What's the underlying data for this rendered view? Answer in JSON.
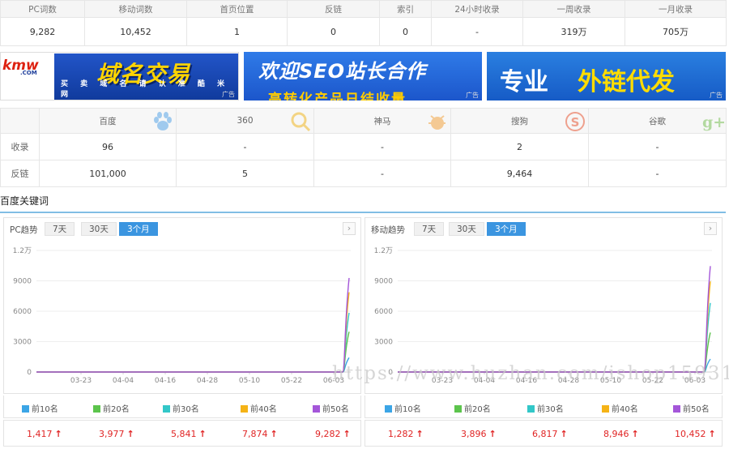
{
  "stats": {
    "headers": [
      "PC词数",
      "移动词数",
      "首页位置",
      "反链",
      "索引",
      "24小时收录",
      "一周收录",
      "一月收录"
    ],
    "values": [
      "9,282",
      "10,452",
      "1",
      "0",
      "0",
      "-",
      "319万",
      "705万"
    ]
  },
  "ads": {
    "ad1": {
      "logo_main": "kmw",
      "logo_suffix": ".COM",
      "title": "域名交易",
      "sub": "买 卖 域 名 请 认 准 酷 米 网",
      "tag": "广告"
    },
    "ad2": {
      "title": "欢迎SEO站长合作",
      "sub": "高转化产品日结收量",
      "tag": "广告"
    },
    "ad3": {
      "w1": "专业",
      "w2": "外链代发",
      "tag": "广告"
    }
  },
  "engines": {
    "headers": [
      "百度",
      "360",
      "神马",
      "搜狗",
      "谷歌"
    ],
    "rows": [
      {
        "label": "收录",
        "values": [
          "96",
          "-",
          "-",
          "2",
          "-"
        ]
      },
      {
        "label": "反链",
        "values": [
          "101,000",
          "5",
          "-",
          "9,464",
          "-"
        ]
      }
    ]
  },
  "section_title": "百度关键词",
  "panels": [
    {
      "title": "PC趋势",
      "tabs": [
        "7天",
        "30天",
        "3个月"
      ],
      "active_tab": "3个月",
      "nav": "›",
      "legend": [
        "前10名",
        "前20名",
        "前30名",
        "前40名",
        "前50名"
      ],
      "values": [
        "1,417",
        "3,977",
        "5,841",
        "7,874",
        "9,282"
      ],
      "arrow": "↑"
    },
    {
      "title": "移动趋势",
      "tabs": [
        "7天",
        "30天",
        "3个月"
      ],
      "active_tab": "3个月",
      "nav": "›",
      "legend": [
        "前10名",
        "前20名",
        "前30名",
        "前40名",
        "前50名"
      ],
      "values": [
        "1,282",
        "3,896",
        "6,817",
        "8,946",
        "10,452"
      ],
      "arrow": "↑"
    }
  ],
  "colors": {
    "series": [
      "#3ba5e6",
      "#5cc44c",
      "#32c7c8",
      "#f5b316",
      "#a456d9"
    ],
    "active_tab": "#3b95e0",
    "up": "#e02424"
  },
  "chart_data": [
    {
      "type": "line",
      "ylim": [
        0,
        12000
      ],
      "yticks": [
        "0",
        "3000",
        "6000",
        "9000",
        "1.2万"
      ],
      "xticks": [
        "03-23",
        "04-04",
        "04-16",
        "04-28",
        "05-10",
        "05-22",
        "06-03"
      ],
      "series": [
        {
          "name": "前10名",
          "values": [
            0,
            0,
            0,
            0,
            0,
            0,
            0,
            1417
          ]
        },
        {
          "name": "前20名",
          "values": [
            0,
            0,
            0,
            0,
            0,
            0,
            0,
            3977
          ]
        },
        {
          "name": "前30名",
          "values": [
            0,
            0,
            0,
            0,
            0,
            0,
            0,
            5841
          ]
        },
        {
          "name": "前40名",
          "values": [
            0,
            0,
            0,
            0,
            0,
            0,
            0,
            7874
          ]
        },
        {
          "name": "前50名",
          "values": [
            0,
            0,
            0,
            0,
            0,
            0,
            0,
            9282
          ]
        }
      ]
    },
    {
      "type": "line",
      "ylim": [
        0,
        12000
      ],
      "yticks": [
        "0",
        "3000",
        "6000",
        "9000",
        "1.2万"
      ],
      "xticks": [
        "03-23",
        "04-04",
        "04-16",
        "04-28",
        "05-10",
        "05-22",
        "06-03"
      ],
      "series": [
        {
          "name": "前10名",
          "values": [
            0,
            0,
            0,
            0,
            0,
            0,
            0,
            1282
          ]
        },
        {
          "name": "前20名",
          "values": [
            0,
            0,
            0,
            0,
            0,
            0,
            0,
            3896
          ]
        },
        {
          "name": "前30名",
          "values": [
            0,
            0,
            0,
            0,
            0,
            0,
            0,
            6817
          ]
        },
        {
          "name": "前40名",
          "values": [
            0,
            0,
            0,
            0,
            0,
            0,
            0,
            8946
          ]
        },
        {
          "name": "前50名",
          "values": [
            0,
            0,
            0,
            0,
            0,
            0,
            0,
            10452
          ]
        }
      ]
    }
  ],
  "watermark": "https://www.huzhan.com/ishop15931"
}
